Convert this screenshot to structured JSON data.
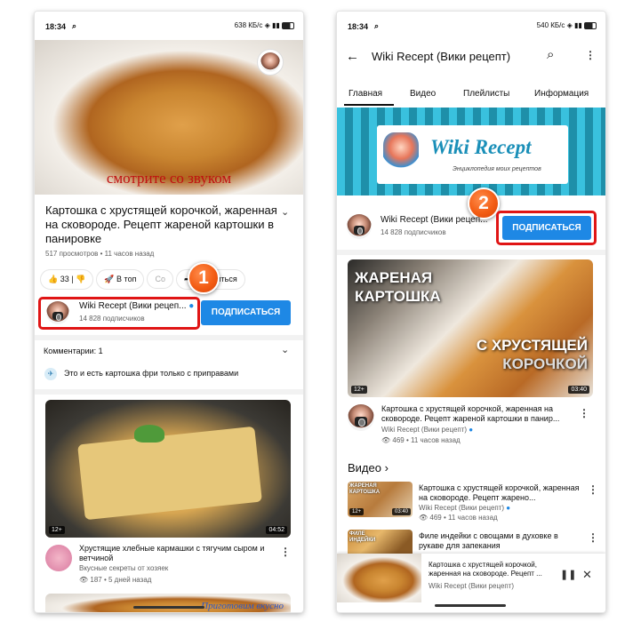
{
  "left": {
    "status": {
      "time": "18:34",
      "net": "638 КБ/с",
      "sig": "Vo LTE2 ▲▼"
    },
    "hero": {
      "overlay": "смотрите со звуком"
    },
    "video_title": "Картошка с хрустящей корочкой, жаренная на сковороде. Рецепт жареной картошки в панировке",
    "stats": "517 просмотров • 11 часов назад",
    "actions": {
      "likes": "33",
      "dislike": "",
      "share": "В топ",
      "save": "Со",
      "share2": "Поделиться"
    },
    "channel": {
      "name": "Wiki Recept (Вики рецеп...",
      "subs": "14 828 подписчиков",
      "subscribe": "ПОДПИСАТЬСЯ"
    },
    "badge": "1",
    "comments": {
      "header": "Комментарии: 1",
      "text": "Это и есть картошка фри только с приправами"
    },
    "next": {
      "duration": "04:52",
      "age": "12+",
      "title": "Хрустящие хлебные кармашки с тягучим сыром и ветчиной",
      "channel": "Вкусные секреты от хозяек",
      "stats": "187 • 5 дней назад",
      "peek": "Приготовим вкусно"
    }
  },
  "right": {
    "status": {
      "time": "18:34",
      "net": "540 КБ/с"
    },
    "header": {
      "title": "Wiki Recept (Вики рецепт)"
    },
    "tabs": [
      "Главная",
      "Видео",
      "Плейлисты",
      "Информация"
    ],
    "banner": {
      "brand": "Wiki Recept",
      "tagline": "Энциклопедия моих рецептов"
    },
    "channel": {
      "name": "Wiki Recept (Вики рецеп...",
      "subs": "14 828 подписчиков",
      "subscribe": "ПОДПИСАТЬСЯ"
    },
    "badge": "2",
    "featured": {
      "overlay1": "ЖАРЕНАЯ",
      "overlay2": "КАРТОШКА",
      "overlay3": "С ХРУСТЯЩЕЙ",
      "overlay4": "КОРОЧКОЙ",
      "age": "12+",
      "duration": "03:40",
      "title": "Картошка с хрустящей корочкой, жаренная на сковороде. Рецепт жареной картошки в панир...",
      "channel": "Wiki Recept (Вики рецепт)",
      "stats": "469 • 11 часов назад"
    },
    "section": {
      "title": "Видео",
      "arrow": "›"
    },
    "videos": [
      {
        "thumb_label": "ЖАРЕНАЯ КАРТОШКА",
        "duration": "03:40",
        "age": "12+",
        "title": "Картошка с хрустящей корочкой, жаренная на сковороде. Рецепт жарено...",
        "channel": "Wiki Recept (Вики рецепт)",
        "stats": "469 • 11 часов назад"
      },
      {
        "thumb_label": "ФИЛЕ ИНДЕЙКИ",
        "duration": "",
        "age": "",
        "title": "Филе индейки с овощами в духовке в рукаве для запекания",
        "channel": "",
        "stats": ""
      }
    ],
    "miniplayer": {
      "title": "Картошка с хрустящей корочкой, жаренная на сковороде. Рецепт ...",
      "channel": "Wiki Recept (Вики рецепт)",
      "pause": "❚❚",
      "close": "✕"
    }
  }
}
